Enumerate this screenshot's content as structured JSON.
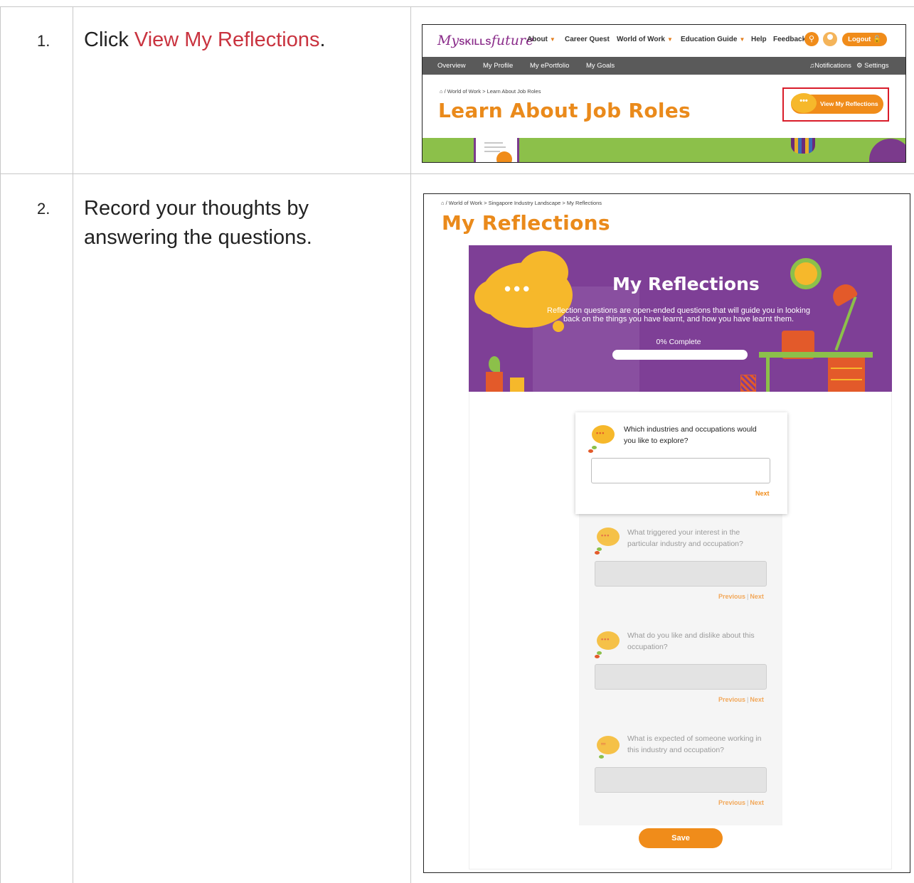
{
  "steps": [
    {
      "number": "1.",
      "text_prefix": "Click ",
      "text_link": "View My Reflections",
      "text_suffix": "."
    },
    {
      "number": "2.",
      "text": "Record your thoughts by answering the questions."
    }
  ],
  "screenshot1": {
    "logo": {
      "my": "My",
      "skills": "SKILLS",
      "future": "future"
    },
    "top_nav": [
      {
        "label": "About",
        "caret": true
      },
      {
        "label": "Career Quest",
        "caret": false
      },
      {
        "label": "World of Work",
        "caret": true
      },
      {
        "label": "Education Guide",
        "caret": true
      },
      {
        "label": "Help",
        "caret": false
      },
      {
        "label": "Feedback",
        "caret": false
      }
    ],
    "logout_label": "Logout",
    "sub_nav": [
      "Overview",
      "My Profile",
      "My ePortfolio",
      "My Goals"
    ],
    "notifications_label": "Notifications",
    "settings_label": "Settings",
    "breadcrumb": "/ World of Work > Learn About Job Roles",
    "page_title": "Learn About Job Roles",
    "reflections_button": "View My Reflections",
    "bubble_dots": "•••"
  },
  "screenshot2": {
    "breadcrumb": "/ World of Work > Singapore Industry Landscape > My Reflections",
    "page_title": "My Reflections",
    "banner": {
      "title": "My Reflections",
      "description": "Reflection questions are open-ended questions that will guide you in looking back on the things you have learnt, and how you have learnt them.",
      "progress_label": "0% Complete",
      "progress": 0,
      "dots": "•••"
    },
    "questions": [
      {
        "text": "Which industries and occupations would you like to explore?",
        "next": "Next",
        "previous": ""
      },
      {
        "text": "What triggered your interest in the particular industry and occupation?",
        "next": "Next",
        "previous": "Previous"
      },
      {
        "text": "What do you like and dislike about this occupation?",
        "next": "Next",
        "previous": "Previous"
      },
      {
        "text": "What is expected of someone working in this industry and occupation?",
        "next": "Next",
        "previous": "Previous"
      }
    ],
    "separator": "|",
    "save_label": "Save"
  },
  "colors": {
    "accent_orange": "#f08c1a",
    "title_orange": "#ea8a1b",
    "link_red": "#c9333f",
    "banner_purple": "#7e3f96",
    "highlight_red": "#d91c2a"
  },
  "icons": [
    "home-icon",
    "search-icon",
    "avatar-icon",
    "lock-icon",
    "bell-icon",
    "gear-icon",
    "speech-bubble-icon"
  ]
}
